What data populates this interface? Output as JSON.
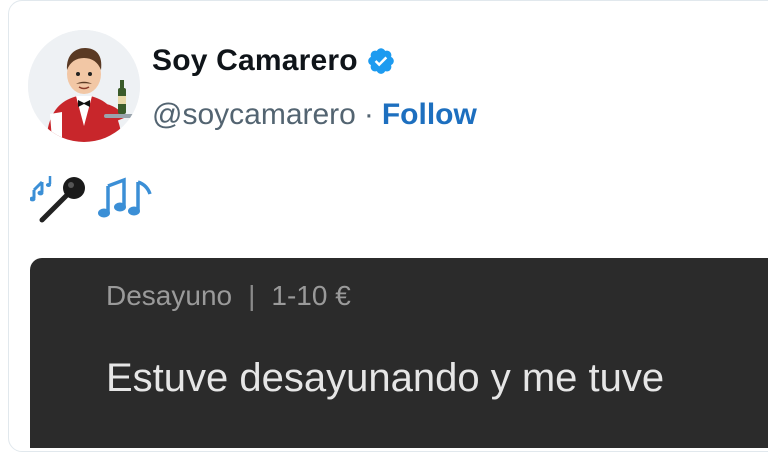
{
  "tweet": {
    "author_name": "Soy Camarero",
    "handle": "@soycamarero",
    "separator": "·",
    "follow_label": "Follow",
    "emojis": [
      "musical-notes-microphone-icon",
      "musical-notes-icon"
    ]
  },
  "embedded": {
    "category": "Desayuno",
    "divider": "|",
    "price_range": "1-10 €",
    "text": "Estuve desayunando y me tuve"
  },
  "colors": {
    "verified": "#1d9bf0",
    "follow": "#1d6fbf",
    "dark_panel": "#2b2b2b",
    "notes": "#3b8fd6"
  }
}
